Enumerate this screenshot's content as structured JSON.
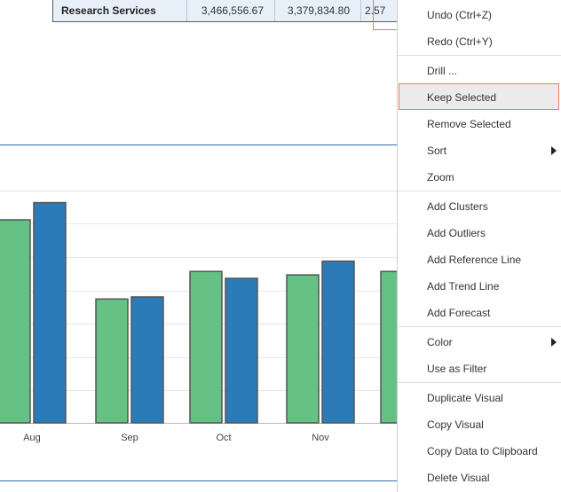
{
  "table": {
    "row_label": "Research Services",
    "values": [
      "3,466,556.67",
      "3,379,834.80",
      "2.57"
    ]
  },
  "chart_data": {
    "type": "bar",
    "categories": [
      "Aug",
      "Sep",
      "Oct",
      "Nov"
    ],
    "series": [
      {
        "color": "#66c184",
        "values": [
          2.95,
          1.8,
          2.2,
          2.15
        ]
      },
      {
        "color": "#2b7bb9",
        "values": [
          3.2,
          1.83,
          2.1,
          2.35
        ]
      }
    ],
    "ylim": [
      0,
      3.8
    ]
  },
  "menu": {
    "items": [
      {
        "label": "Undo (Ctrl+Z)"
      },
      {
        "label": "Redo (Ctrl+Y)"
      },
      {
        "label": "Drill ..."
      },
      {
        "label": "Keep Selected"
      },
      {
        "label": "Remove Selected"
      },
      {
        "label": "Sort"
      },
      {
        "label": "Zoom"
      },
      {
        "label": "Add Clusters"
      },
      {
        "label": "Add Outliers"
      },
      {
        "label": "Add Reference Line"
      },
      {
        "label": "Add Trend Line"
      },
      {
        "label": "Add Forecast"
      },
      {
        "label": "Color"
      },
      {
        "label": "Use as Filter"
      },
      {
        "label": "Duplicate Visual"
      },
      {
        "label": "Copy Visual"
      },
      {
        "label": "Copy Data to Clipboard"
      },
      {
        "label": "Delete Visual"
      }
    ]
  }
}
